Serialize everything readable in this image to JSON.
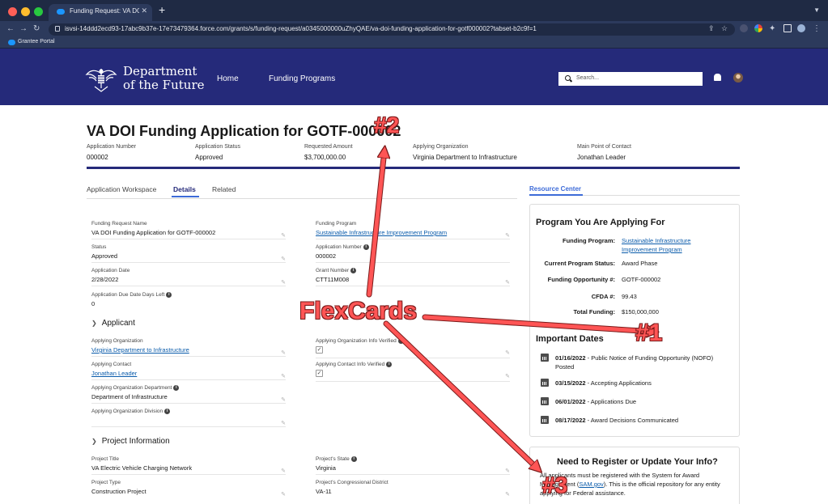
{
  "browser": {
    "tab_title": "Funding Request: VA DOI Fundi...",
    "url": "isvsi-14ddd2ecd93-17abc9b37e-17e73479364.force.com/grants/s/funding-request/a0345000000uZhyQAE/va-doi-funding-application-for-gotf000002?tabset-b2c9f=1",
    "bookmark": "Grantee Portal"
  },
  "header": {
    "brand_line1": "Department",
    "brand_line2": "of the Future",
    "nav": [
      "Home",
      "Funding Programs"
    ],
    "search_placeholder": "Search..."
  },
  "record": {
    "title": "VA DOI Funding Application for GOTF-000002",
    "highlights": [
      {
        "label": "Application Number",
        "value": "000002"
      },
      {
        "label": "Application Status",
        "value": "Approved"
      },
      {
        "label": "Requested Amount",
        "value": "$3,700,000.00"
      },
      {
        "label": "Applying Organization",
        "value": "Virginia Department to Infrastructure"
      },
      {
        "label": "Main Point of Contact",
        "value": "Jonathan Leader"
      }
    ]
  },
  "tabs": {
    "items": [
      "Application Workspace",
      "Details",
      "Related"
    ],
    "active": "Details",
    "resource_center": "Resource Center"
  },
  "details": {
    "left": [
      {
        "label": "Funding Request Name",
        "value": "VA DOI Funding Application for GOTF-000002"
      },
      {
        "label": "Status",
        "value": "Approved"
      },
      {
        "label": "Application Date",
        "value": "2/28/2022"
      },
      {
        "label": "Application Due Date Days Left",
        "value": "0"
      }
    ],
    "right": [
      {
        "label": "Funding Program",
        "value": "Sustainable Infrastructure Improvement Program"
      },
      {
        "label": "Application Number",
        "value": "000002"
      },
      {
        "label": "Grant Number",
        "value": "CTT11M008"
      }
    ]
  },
  "applicant": {
    "section_title": "Applicant",
    "left": [
      {
        "label": "Applying Organization",
        "value": "Virginia Department to Infrastructure"
      },
      {
        "label": "Applying Contact",
        "value": "Jonathan Leader"
      },
      {
        "label": "Applying Organization Department",
        "value": "Department of Infrastructure"
      },
      {
        "label": "Applying Organization Division",
        "value": ""
      }
    ],
    "right": [
      {
        "label": "Applying Organization Info Verified",
        "checked": true
      },
      {
        "label": "Applying Contact Info Verified",
        "checked": true
      }
    ]
  },
  "project": {
    "section_title": "Project Information",
    "left": [
      {
        "label": "Project Title",
        "value": "VA Electric Vehicle Charging Network"
      },
      {
        "label": "Project Type",
        "value": "Construction Project"
      }
    ],
    "right": [
      {
        "label": "Project's State",
        "value": "Virginia"
      },
      {
        "label": "Project's Congressional District",
        "value": "VA-11"
      }
    ]
  },
  "program_card": {
    "title": "Program You Are Applying For",
    "rows": [
      {
        "key": "Funding Program:",
        "value": "Sustainable Infrastructure Improvement Program"
      },
      {
        "key": "Current Program Status:",
        "value": "Award Phase"
      },
      {
        "key": "Funding Opportunity #:",
        "value": "GOTF-000002"
      },
      {
        "key": "CFDA #:",
        "value": "99.43"
      },
      {
        "key": "Total Funding:",
        "value": "$150,000,000"
      }
    ]
  },
  "dates_card": {
    "title": "Important Dates",
    "items": [
      {
        "date": "01/16/2022",
        "text": " - Public Notice of Funding Opportunity (NOFO) Posted"
      },
      {
        "date": "03/15/2022",
        "text": " - Accepting Applications"
      },
      {
        "date": "06/01/2022",
        "text": " - Applications Due"
      },
      {
        "date": "08/17/2022",
        "text": " - Award Decisions Communicated"
      }
    ]
  },
  "register_card": {
    "title": "Need to Register or Update Your Info?",
    "text_a": "All applicants must be registered with the System for Award Management (",
    "link": "SAM.gov",
    "text_b": ").  This is the official repository for any entity applying for Federal assistance."
  },
  "annotations": {
    "main": "FlexCards",
    "n1": "#1",
    "n2": "#2",
    "n3": "#3",
    "color": "#ff5555"
  }
}
